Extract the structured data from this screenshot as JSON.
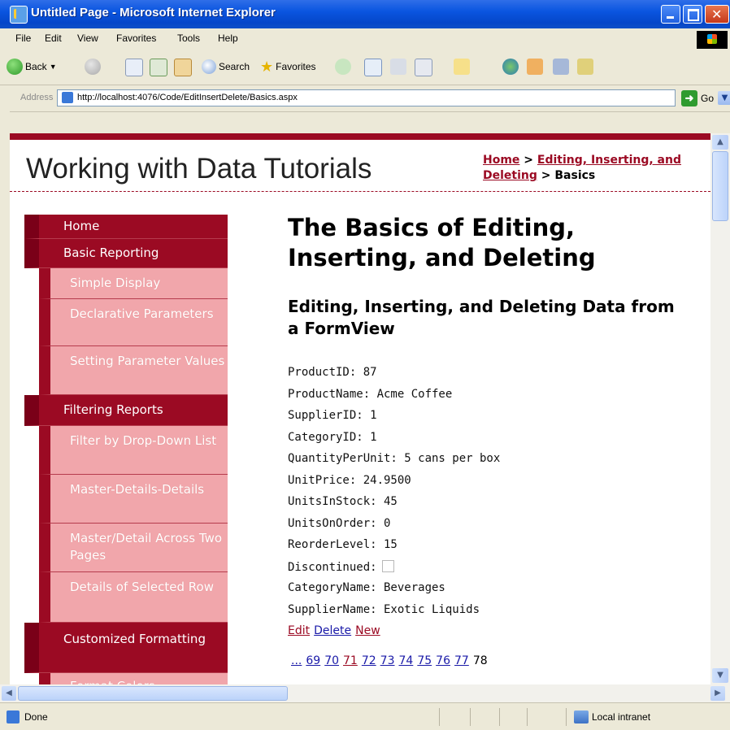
{
  "window": {
    "title": "Untitled Page - Microsoft Internet Explorer"
  },
  "menu": [
    "File",
    "Edit",
    "View",
    "Favorites",
    "Tools",
    "Help"
  ],
  "toolbar": {
    "back": "Back",
    "search": "Search",
    "favorites": "Favorites"
  },
  "address": {
    "label": "Address",
    "url": "http://localhost:4076/Code/EditInsertDelete/Basics.aspx",
    "go": "Go"
  },
  "site": {
    "title": "Working with Data Tutorials"
  },
  "breadcrumb": {
    "home": "Home",
    "sep1": " > ",
    "section": "Editing, Inserting, and Deleting",
    "sep2": " > ",
    "current": "Basics"
  },
  "sidemenu": [
    {
      "label": "Home",
      "type": "cat"
    },
    {
      "label": "Basic Reporting",
      "type": "cat"
    },
    {
      "label": "Simple Display",
      "type": "sub"
    },
    {
      "label": "Declarative Parameters",
      "type": "sub"
    },
    {
      "label": "Setting Parameter Values",
      "type": "sub"
    },
    {
      "label": "Filtering Reports",
      "type": "cat"
    },
    {
      "label": "Filter by Drop-Down List",
      "type": "sub"
    },
    {
      "label": "Master-Details-Details",
      "type": "sub"
    },
    {
      "label": "Master/Detail Across Two Pages",
      "type": "sub"
    },
    {
      "label": "Details of Selected Row",
      "type": "sub"
    },
    {
      "label": "Customized Formatting",
      "type": "cat"
    },
    {
      "label": "Format Colors",
      "type": "sub"
    }
  ],
  "main": {
    "heading": "The Basics of Editing, Inserting, and Deleting",
    "subheading": "Editing, Inserting, and Deleting Data from a FormView",
    "fields": [
      "ProductID: 87",
      "ProductName: Acme Coffee",
      "SupplierID: 1",
      "CategoryID: 1",
      "QuantityPerUnit: 5 cans per box",
      "UnitPrice: 24.9500",
      "UnitsInStock: 45",
      "UnitsOnOrder: 0",
      "ReorderLevel: 15",
      "Discontinued:",
      "CategoryName: Beverages",
      "SupplierName: Exotic Liquids"
    ],
    "actions": {
      "edit": "Edit",
      "delete": "Delete",
      "new": "New"
    },
    "pager": {
      "ellipsis": "...",
      "pages": [
        "69",
        "70",
        "71",
        "72",
        "73",
        "74",
        "75",
        "76",
        "77"
      ],
      "current": "78"
    }
  },
  "status": {
    "text": "Done",
    "zone": "Local intranet"
  },
  "colors": {
    "accent": "#9b0a23",
    "submenu": "#f1a6ab",
    "titlebar": "#0a55e0"
  }
}
